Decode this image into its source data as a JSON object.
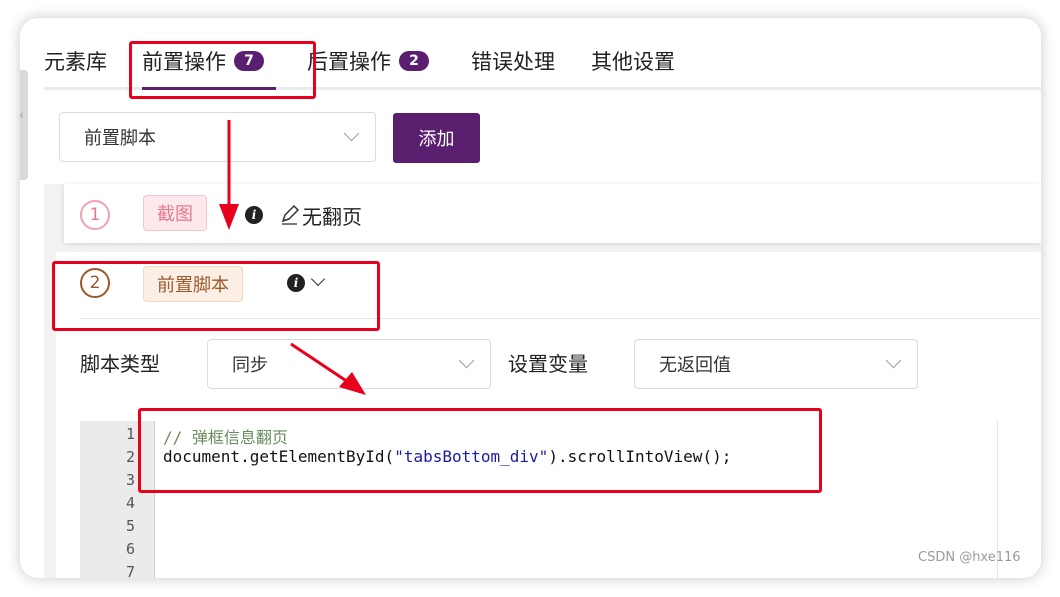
{
  "tabs": [
    {
      "label": "元素库",
      "badge": ""
    },
    {
      "label": "前置操作",
      "badge": "7"
    },
    {
      "label": "后置操作",
      "badge": "2"
    },
    {
      "label": "错误处理",
      "badge": ""
    },
    {
      "label": "其他设置",
      "badge": ""
    }
  ],
  "toolbar": {
    "type_select_value": "前置脚本",
    "add_label": "添加"
  },
  "items": [
    {
      "index": "1",
      "tag": "截图",
      "title": "无翻页"
    },
    {
      "index": "2",
      "tag": "前置脚本"
    }
  ],
  "script_form": {
    "type_label": "脚本类型",
    "type_value": "同步",
    "var_label": "设置变量",
    "var_value": "无返回值"
  },
  "editor": {
    "line_numbers": [
      "1",
      "2",
      "3",
      "4",
      "5",
      "6",
      "7"
    ],
    "line1_comment": "// 弹框信息翻页",
    "line2_pre": "document.getElementById(",
    "line2_str": "\"tabsBottom_div\"",
    "line2_post": ").scrollIntoView();"
  },
  "watermark": "CSDN @hxe116",
  "colors": {
    "accent": "#5a1f6e",
    "annotation": "#e8001c",
    "tag1_bg": "#fde8ec",
    "tag2_bg": "#fbeee4"
  },
  "icons": [
    "chevron-left-icon",
    "chevron-down-icon",
    "info-icon",
    "edit-pencil-icon"
  ]
}
